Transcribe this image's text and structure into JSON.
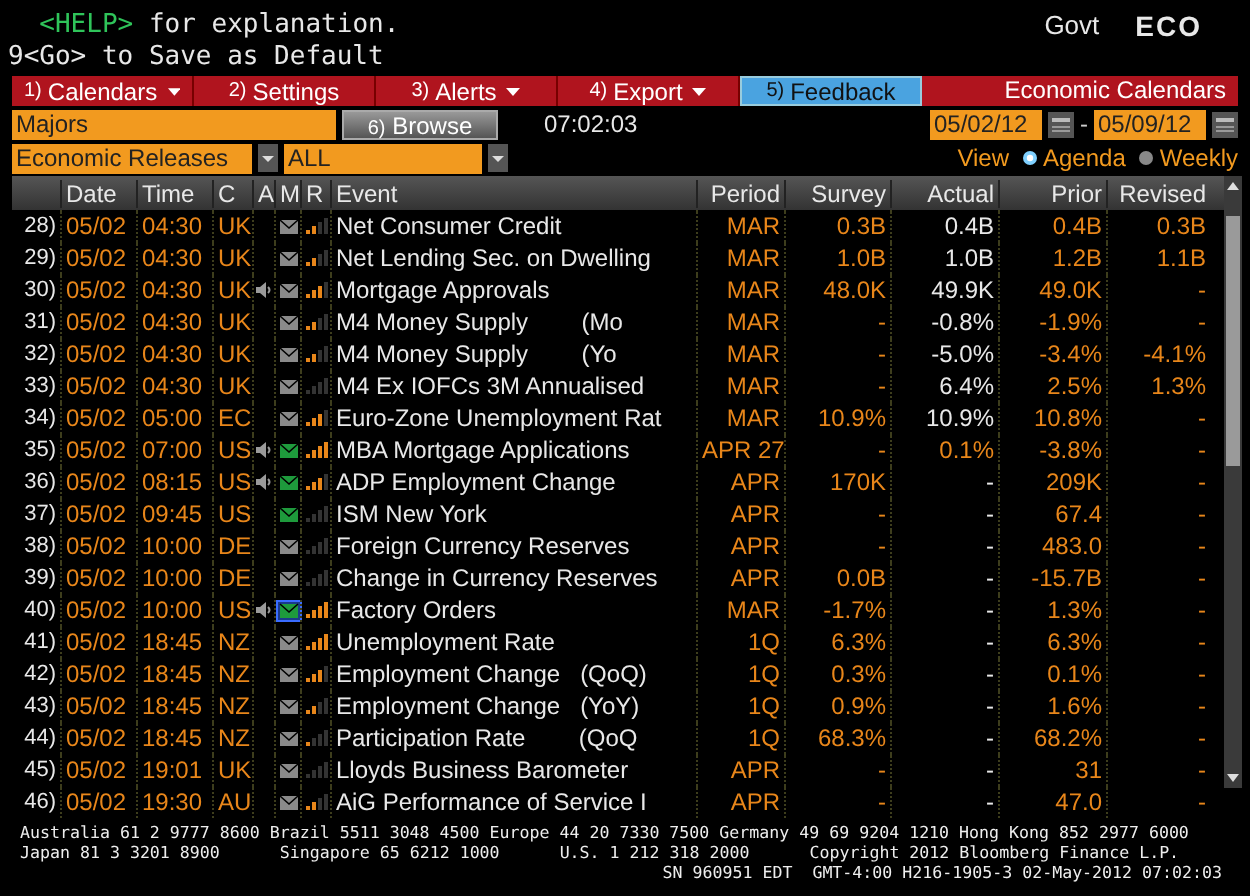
{
  "header": {
    "help_key": "<HELP>",
    "help_text": "for explanation.",
    "default_text": "9<Go> to Save as Default",
    "sector": "Govt",
    "function": "ECO"
  },
  "menu": [
    {
      "number": "1)",
      "label": "Calendars",
      "dropdown": true,
      "kind": "menu"
    },
    {
      "number": "2)",
      "label": "Settings",
      "dropdown": false,
      "kind": "menu"
    },
    {
      "number": "3)",
      "label": "Alerts",
      "dropdown": true,
      "kind": "menu"
    },
    {
      "number": "4)",
      "label": "Export",
      "dropdown": true,
      "kind": "menu"
    },
    {
      "number": "5)",
      "label": "Feedback",
      "dropdown": false,
      "kind": "feedback"
    }
  ],
  "page_title": "Economic Calendars",
  "filters": {
    "list": "Majors",
    "browse": {
      "number": "6)",
      "label": "Browse"
    },
    "time": "07:02:03",
    "start_date": "05/02/12",
    "separator": "-",
    "end_date": "05/09/12",
    "type": "Economic Releases",
    "region": "ALL",
    "view_label": "View",
    "view_options": [
      {
        "label": "Agenda",
        "selected": true
      },
      {
        "label": "Weekly",
        "selected": false
      }
    ]
  },
  "columns": [
    "Date",
    "Time",
    "C",
    "A",
    "M",
    "R",
    "Event",
    "Period",
    "Survey",
    "Actual",
    "Prior",
    "Revised"
  ],
  "rows": [
    {
      "num": "28)",
      "date": "05/02",
      "time": "04:30",
      "country": "UK",
      "alert": false,
      "envelope": {
        "color": "#8a8a8a"
      },
      "selected": false,
      "meter": {
        "kind": "medium"
      },
      "event": "Net Consumer Credit",
      "period": "MAR",
      "survey": "0.3B",
      "actual": {
        "text": "0.4B",
        "color": "#e8e8e8"
      },
      "prior": "0.4B",
      "revised": "0.3B"
    },
    {
      "num": "29)",
      "date": "05/02",
      "time": "04:30",
      "country": "UK",
      "alert": false,
      "envelope": {
        "color": "#8a8a8a"
      },
      "selected": false,
      "meter": {
        "kind": "medium"
      },
      "event": "Net Lending Sec. on Dwelling",
      "period": "MAR",
      "survey": "1.0B",
      "actual": {
        "text": "1.0B",
        "color": "#e8e8e8"
      },
      "prior": "1.2B",
      "revised": "1.1B"
    },
    {
      "num": "30)",
      "date": "05/02",
      "time": "04:30",
      "country": "UK",
      "alert": true,
      "envelope": {
        "color": "#8a8a8a"
      },
      "selected": false,
      "meter": {
        "kind": "high"
      },
      "event": "Mortgage Approvals",
      "period": "MAR",
      "survey": "48.0K",
      "actual": {
        "text": "49.9K",
        "color": "#e8e8e8"
      },
      "prior": "49.0K",
      "revised": "-"
    },
    {
      "num": "31)",
      "date": "05/02",
      "time": "04:30",
      "country": "UK",
      "alert": false,
      "envelope": {
        "color": "#8a8a8a"
      },
      "selected": false,
      "meter": {
        "kind": "medium"
      },
      "event": "M4 Money Supply        (Mo",
      "period": "MAR",
      "survey": "-",
      "actual": {
        "text": "-0.8%",
        "color": "#e8e8e8"
      },
      "prior": "-1.9%",
      "revised": "-"
    },
    {
      "num": "32)",
      "date": "05/02",
      "time": "04:30",
      "country": "UK",
      "alert": false,
      "envelope": {
        "color": "#8a8a8a"
      },
      "selected": false,
      "meter": {
        "kind": "medium"
      },
      "event": "M4 Money Supply        (Yo",
      "period": "MAR",
      "survey": "-",
      "actual": {
        "text": "-5.0%",
        "color": "#e8e8e8"
      },
      "prior": "-3.4%",
      "revised": "-4.1%"
    },
    {
      "num": "33)",
      "date": "05/02",
      "time": "04:30",
      "country": "UK",
      "alert": false,
      "envelope": {
        "color": "#8a8a8a"
      },
      "selected": false,
      "meter": {
        "kind": "none"
      },
      "event": "M4 Ex IOFCs 3M Annualised",
      "period": "MAR",
      "survey": "-",
      "actual": {
        "text": "6.4%",
        "color": "#e8e8e8"
      },
      "prior": "2.5%",
      "revised": "1.3%"
    },
    {
      "num": "34)",
      "date": "05/02",
      "time": "05:00",
      "country": "EC",
      "alert": false,
      "envelope": {
        "color": "#8a8a8a"
      },
      "selected": false,
      "meter": {
        "kind": "high"
      },
      "event": "Euro-Zone Unemployment Rat",
      "period": "MAR",
      "survey": "10.9%",
      "actual": {
        "text": "10.9%",
        "color": "#e8e8e8"
      },
      "prior": "10.8%",
      "revised": "-"
    },
    {
      "num": "35)",
      "date": "05/02",
      "time": "07:00",
      "country": "US",
      "alert": true,
      "envelope": {
        "color": "#1e9a3c"
      },
      "selected": false,
      "meter": {
        "kind": "top"
      },
      "event": "MBA Mortgage Applications",
      "period": "APR 27",
      "survey": "-",
      "actual": {
        "text": "0.1%",
        "color": "#e8861a"
      },
      "prior": "-3.8%",
      "revised": "-"
    },
    {
      "num": "36)",
      "date": "05/02",
      "time": "08:15",
      "country": "US",
      "alert": true,
      "envelope": {
        "color": "#1e9a3c"
      },
      "selected": false,
      "meter": {
        "kind": "high"
      },
      "event": "ADP Employment Change",
      "period": "APR",
      "survey": "170K",
      "actual": {
        "text": "-",
        "color": "#e8e8e8"
      },
      "prior": "209K",
      "revised": "-"
    },
    {
      "num": "37)",
      "date": "05/02",
      "time": "09:45",
      "country": "US",
      "alert": false,
      "envelope": {
        "color": "#1e9a3c"
      },
      "selected": false,
      "meter": {
        "kind": "none"
      },
      "event": "ISM New York",
      "period": "APR",
      "survey": "-",
      "actual": {
        "text": "-",
        "color": "#e8e8e8"
      },
      "prior": "67.4",
      "revised": "-"
    },
    {
      "num": "38)",
      "date": "05/02",
      "time": "10:00",
      "country": "DE",
      "alert": false,
      "envelope": {
        "color": "#8a8a8a"
      },
      "selected": false,
      "meter": {
        "kind": "none"
      },
      "event": "Foreign Currency Reserves",
      "period": "APR",
      "survey": "-",
      "actual": {
        "text": "-",
        "color": "#e8e8e8"
      },
      "prior": "483.0",
      "revised": "-"
    },
    {
      "num": "39)",
      "date": "05/02",
      "time": "10:00",
      "country": "DE",
      "alert": false,
      "envelope": {
        "color": "#8a8a8a"
      },
      "selected": false,
      "meter": {
        "kind": "none"
      },
      "event": "Change in Currency Reserves",
      "period": "APR",
      "survey": "0.0B",
      "actual": {
        "text": "-",
        "color": "#e8e8e8"
      },
      "prior": "-15.7B",
      "revised": "-"
    },
    {
      "num": "40)",
      "date": "05/02",
      "time": "10:00",
      "country": "US",
      "alert": true,
      "envelope": {
        "color": "#1e9a3c"
      },
      "selected": true,
      "meter": {
        "kind": "top"
      },
      "event": "Factory Orders",
      "period": "MAR",
      "survey": "-1.7%",
      "actual": {
        "text": "-",
        "color": "#e8e8e8"
      },
      "prior": "1.3%",
      "revised": "-"
    },
    {
      "num": "41)",
      "date": "05/02",
      "time": "18:45",
      "country": "NZ",
      "alert": false,
      "envelope": {
        "color": "#8a8a8a"
      },
      "selected": false,
      "meter": {
        "kind": "top"
      },
      "event": "Unemployment Rate",
      "period": "1Q",
      "survey": "6.3%",
      "actual": {
        "text": "-",
        "color": "#e8e8e8"
      },
      "prior": "6.3%",
      "revised": "-"
    },
    {
      "num": "42)",
      "date": "05/02",
      "time": "18:45",
      "country": "NZ",
      "alert": false,
      "envelope": {
        "color": "#8a8a8a"
      },
      "selected": false,
      "meter": {
        "kind": "high"
      },
      "event": "Employment Change   (QoQ)",
      "period": "1Q",
      "survey": "0.3%",
      "actual": {
        "text": "-",
        "color": "#e8e8e8"
      },
      "prior": "0.1%",
      "revised": "-"
    },
    {
      "num": "43)",
      "date": "05/02",
      "time": "18:45",
      "country": "NZ",
      "alert": false,
      "envelope": {
        "color": "#8a8a8a"
      },
      "selected": false,
      "meter": {
        "kind": "medium"
      },
      "event": "Employment Change   (YoY)",
      "period": "1Q",
      "survey": "0.9%",
      "actual": {
        "text": "-",
        "color": "#e8e8e8"
      },
      "prior": "1.6%",
      "revised": "-"
    },
    {
      "num": "44)",
      "date": "05/02",
      "time": "18:45",
      "country": "NZ",
      "alert": false,
      "envelope": {
        "color": "#8a8a8a"
      },
      "selected": false,
      "meter": {
        "kind": "low"
      },
      "event": "Participation Rate        (QoQ",
      "period": "1Q",
      "survey": "68.3%",
      "actual": {
        "text": "-",
        "color": "#e8e8e8"
      },
      "prior": "68.2%",
      "revised": "-"
    },
    {
      "num": "45)",
      "date": "05/02",
      "time": "19:01",
      "country": "UK",
      "alert": false,
      "envelope": {
        "color": "#8a8a8a"
      },
      "selected": false,
      "meter": {
        "kind": "none"
      },
      "event": "Lloyds Business Barometer",
      "period": "APR",
      "survey": "-",
      "actual": {
        "text": "-",
        "color": "#e8e8e8"
      },
      "prior": "31",
      "revised": "-"
    },
    {
      "num": "46)",
      "date": "05/02",
      "time": "19:30",
      "country": "AU",
      "alert": false,
      "envelope": {
        "color": "#8a8a8a"
      },
      "selected": false,
      "meter": {
        "kind": "medium"
      },
      "event": "AiG Performance of Service I",
      "period": "APR",
      "survey": "-",
      "actual": {
        "text": "-",
        "color": "#e8e8e8"
      },
      "prior": "47.0",
      "revised": "-"
    }
  ],
  "footer": {
    "lines": [
      [
        "Australia 61 2 9777 8600 Brazil 5511 3048 4500 Europe 44 20 7330 7500 Germany 49 69 9204 1210 Hong Kong 852 2977 6000"
      ],
      [
        "Japan 81 3 3201 8900",
        "Singapore 65 6212 1000",
        "U.S. 1 212 318 2000",
        "Copyright 2012 Bloomberg Finance L.P."
      ],
      [
        "SN 960951 EDT  GMT-4:00 H216-1905-3 02-May-2012 07:02:03"
      ]
    ]
  }
}
